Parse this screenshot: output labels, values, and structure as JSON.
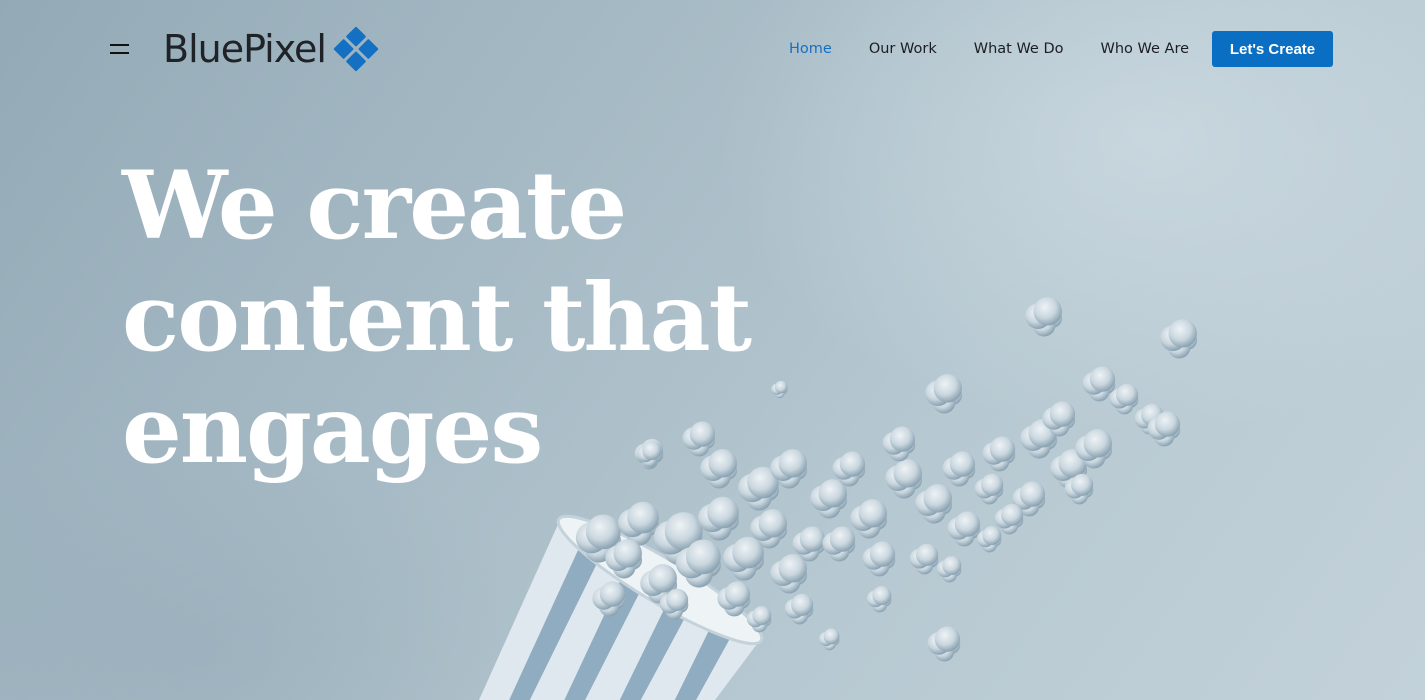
{
  "header": {
    "brand": "BluePixel",
    "nav": [
      {
        "label": "Home",
        "active": true
      },
      {
        "label": "Our Work",
        "active": false
      },
      {
        "label": "What We Do",
        "active": false
      },
      {
        "label": "Who We Are",
        "active": false
      }
    ],
    "cta_label": "Let's Create",
    "menu_icon": "hamburger-icon",
    "logo_icon": "diamond-grid-icon"
  },
  "hero": {
    "title_lines": [
      "We create",
      "content that",
      "engages"
    ],
    "illustration": "popcorn-bucket-spilling"
  },
  "colors": {
    "accent": "#0a6fc2",
    "active_nav": "#1470c2",
    "background": "#a9bdc8",
    "hero_text": "#ffffff"
  }
}
